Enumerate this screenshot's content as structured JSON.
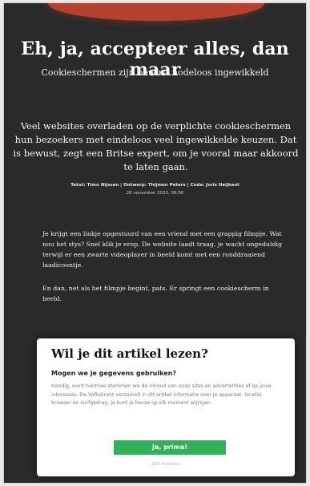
{
  "article": {
    "headline": "Eh, ja, accepteer alles, dan maar",
    "subheadline": "Cookieschermen zijn bewust nodeloos ingewikkeld",
    "intro": "Veel websites overladen op de verplichte cookieschermen hun bezoekers met eindeloos veel ingewikkelde keuzen. Dat is bewust, zegt een Britse expert, om je vooral maar akkoord te laten gaan.",
    "credits": "Tekst: Timo Nijssen | Ontwerp: Thijmen Peters | Code: Joris Heijkant",
    "date": "26 november 2020, 06:00",
    "paragraphs": [
      "Je krijgt een linkje opgestuurd van een vriend met een grappig filmpje. Wat nou het stys? Snel klik je erop. De website laadt traag, je wacht ongeduldig terwijl er een zwarte videoplayer in beeld komt met een ronddraaiend laadicoontje.",
      "En dan, net als het filmpje begint, pats. Er springt een cookiescherm in beeld."
    ]
  },
  "consent": {
    "title": "Wil je dit artikel lezen?",
    "subtitle": "Mogen we je gegevens gebruiken?",
    "body": "Handig, want hiermee stemmen we de inhoud van onze sites en advertenties af op jouw interesses. De Volkskrant verzamelt in dit artikel informatie over je apparaat, locatie, browser en surfgedrag. Je kunt je keuze op elk moment wijzigen.",
    "accept_label": "Ja, prima!",
    "settings_label": "Zelf instellen"
  },
  "colors": {
    "background": "#2a2a2a",
    "accent_red": "#b5412e",
    "accept_green": "#35b05a"
  }
}
